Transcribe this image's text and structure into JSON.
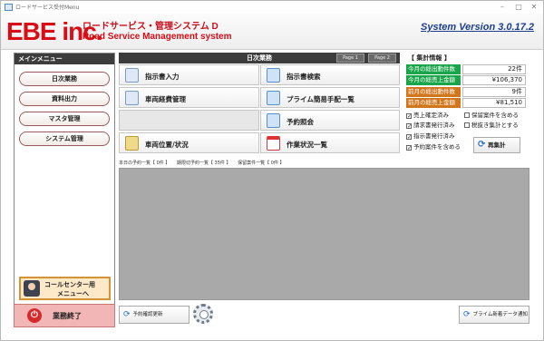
{
  "window": {
    "title": "ロードサービス受付Menu",
    "controls": [
      "–",
      "□",
      "✕"
    ]
  },
  "header": {
    "logo_main": "EBE inc.",
    "product_name": "ロードサービス・管理システム D",
    "logo_sub": "Road Service Management system",
    "version": "System Version 3.0.17.2"
  },
  "sidebar": {
    "title": "メインメニュー",
    "items": [
      {
        "label": "日次業務"
      },
      {
        "label": "資料出力"
      },
      {
        "label": "マスタ管理"
      },
      {
        "label": "システム管理"
      }
    ],
    "callcenter_line1": "コールセンター用",
    "callcenter_line2": "メニューへ",
    "end_label": "業務終了"
  },
  "main": {
    "title": "日次業務",
    "page1": "Page 1",
    "page2": "Page 2",
    "tiles": [
      {
        "label": "指示書入力",
        "icon": "document-edit-icon"
      },
      {
        "label": "指示書検索",
        "icon": "document-search-icon"
      },
      {
        "label": "車両経費管理",
        "icon": "document-edit-icon"
      },
      {
        "label": "プライム簡易手配一覧",
        "icon": "document-search-icon"
      },
      {
        "label": "",
        "icon": ""
      },
      {
        "label": "予約照会",
        "icon": "document-search-icon"
      },
      {
        "label": "車両位置/状況",
        "icon": "vehicle-map-icon"
      },
      {
        "label": "作業状況一覧",
        "icon": "calendar-icon"
      }
    ]
  },
  "stats": {
    "title": "【 集計情報 】",
    "rows": [
      {
        "label": "今月の総出動件数",
        "value": "22件",
        "color": "#19a64a"
      },
      {
        "label": "今月の総売上金額",
        "value": "¥106,370",
        "color": "#19a64a"
      },
      {
        "label": "前月の総出動件数",
        "value": "9件",
        "color": "#d2761c"
      },
      {
        "label": "前月の総売上金額",
        "value": "¥81,510",
        "color": "#d2761c"
      }
    ],
    "checks": [
      {
        "label": "売上確定済み",
        "checked": true
      },
      {
        "label": "保留案件を含める",
        "checked": false
      },
      {
        "label": "請求書発行済み",
        "checked": true
      },
      {
        "label": "税抜き集計とする",
        "checked": false
      },
      {
        "label": "指示書発行済み",
        "checked": true
      },
      {
        "label": "予約案件を含める",
        "checked": true
      }
    ],
    "recalc_label": "再集計"
  },
  "reservations": {
    "today_label": "本日の予約一覧【 0件 】",
    "expired_label": "期限切予約一覧【 35件 】",
    "pending_label": "保留案件一覧【 0件 】"
  },
  "bottom": {
    "reservation_refresh": "予約確認更新",
    "prime_notice": "プライム新着データ通知"
  }
}
